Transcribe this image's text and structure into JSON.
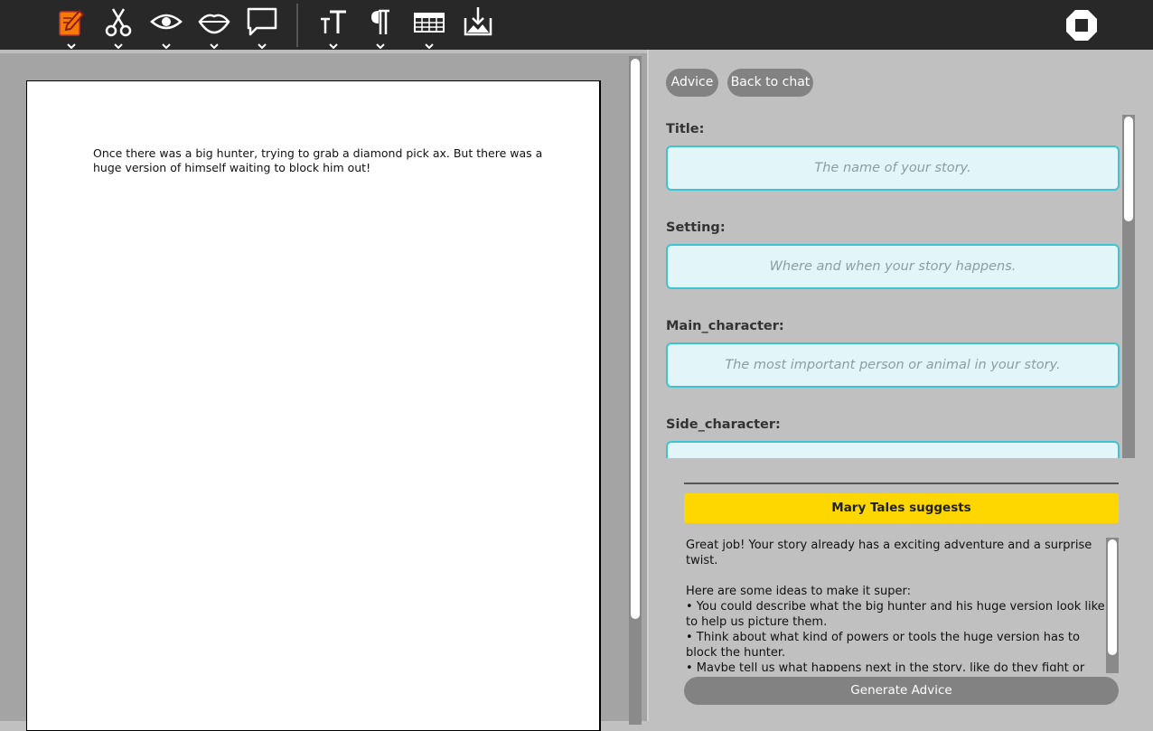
{
  "toolbar": {
    "icons": [
      "edit-document-icon",
      "scissors-icon",
      "eye-icon",
      "lips-icon",
      "speech-bubble-icon",
      "text-size-icon",
      "paragraph-icon",
      "table-icon",
      "save-image-icon",
      "stop-icon"
    ],
    "accent_color": "#f57c00"
  },
  "document": {
    "text": "Once there was a big hunter, trying to grab a diamond pick ax. But there was a huge version of himself waiting to block him out!"
  },
  "panel": {
    "advice_button": "Advice",
    "back_button": "Back to chat",
    "fields": [
      {
        "label": "Title:",
        "placeholder": "The name of your story."
      },
      {
        "label": "Setting:",
        "placeholder": "Where and when your story happens."
      },
      {
        "label": "Main_character:",
        "placeholder": "The most important person or animal in your story."
      },
      {
        "label": "Side_character:",
        "placeholder": ""
      }
    ],
    "field_border_color": "#3cc4d2"
  },
  "advice": {
    "heading": "Mary Tales suggests",
    "heading_color": "#ffd700",
    "text": "Great job! Your story already has a exciting adventure and a surprise twist.\n\nHere are some ideas to make it super:\n• You could describe what the big hunter and his huge version look like to help us picture them.\n• Think about what kind of powers or tools the huge version has to block the hunter.\n• Maybe tell us what happens next in the story, like do they fight or",
    "generate_button": "Generate Advice"
  }
}
